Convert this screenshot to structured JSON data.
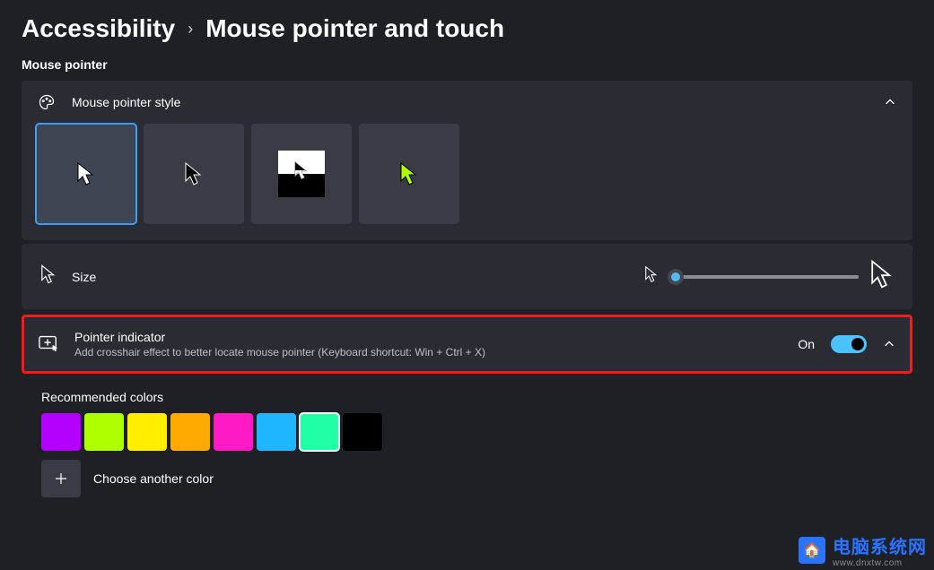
{
  "breadcrumb": {
    "parent": "Accessibility",
    "current": "Mouse pointer and touch"
  },
  "section_mouse_pointer": "Mouse pointer",
  "card_style": {
    "label": "Mouse pointer style",
    "options": [
      "white",
      "black",
      "inverted",
      "custom"
    ],
    "selected": 0
  },
  "size_row": {
    "label": "Size",
    "value_percent": 3
  },
  "pointer_indicator": {
    "title": "Pointer indicator",
    "subtitle": "Add crosshair effect to better locate mouse pointer (Keyboard shortcut: Win + Ctrl + X)",
    "state_label": "On",
    "on": true
  },
  "recommended": {
    "label": "Recommended colors",
    "colors": [
      "#b400ff",
      "#b0ff00",
      "#ffee00",
      "#ffaa00",
      "#ff1ac6",
      "#1fb6ff",
      "#1fffa5",
      "#000000"
    ],
    "selected_index": 6,
    "choose_label": "Choose another color"
  },
  "watermark": {
    "main": "电脑系统网",
    "sub": "www.dnxtw.com"
  },
  "chart_data": null
}
